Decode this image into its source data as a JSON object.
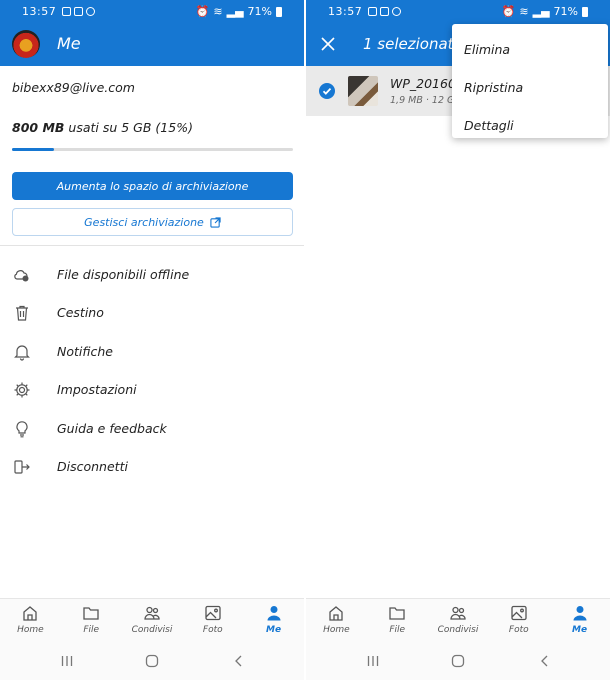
{
  "status": {
    "time": "13:57",
    "battery": "71%"
  },
  "left": {
    "header": {
      "title": "Me"
    },
    "account": {
      "email": "bibexx89@live.com",
      "usage_used": "800 MB",
      "usage_rest": "usati su 5 GB (15%)",
      "usage_fraction": 0.15
    },
    "buttons": {
      "increase_storage": "Aumenta lo spazio di archiviazione",
      "manage_storage": "Gestisci archiviazione"
    },
    "menu": [
      {
        "label": "File disponibili offline",
        "icon": "cloud-offline-icon"
      },
      {
        "label": "Cestino",
        "icon": "trash-icon"
      },
      {
        "label": "Notifiche",
        "icon": "bell-icon"
      },
      {
        "label": "Impostazioni",
        "icon": "gear-icon"
      },
      {
        "label": "Guida e feedback",
        "icon": "lightbulb-icon"
      },
      {
        "label": "Disconnetti",
        "icon": "sign-out-icon"
      }
    ]
  },
  "right": {
    "header": {
      "title": "1 selezionati"
    },
    "file": {
      "name": "WP_20160",
      "meta": "1,9 MB · 12 G"
    },
    "dropdown": [
      "Elimina",
      "Ripristina",
      "Dettagli"
    ]
  },
  "bottom_nav": [
    {
      "label": "Home",
      "icon": "home-icon"
    },
    {
      "label": "File",
      "icon": "folder-icon"
    },
    {
      "label": "Condivisi",
      "icon": "people-icon"
    },
    {
      "label": "Foto",
      "icon": "photo-icon"
    },
    {
      "label": "Me",
      "icon": "person-icon",
      "active": true
    }
  ],
  "colors": {
    "accent": "#1677d2"
  }
}
